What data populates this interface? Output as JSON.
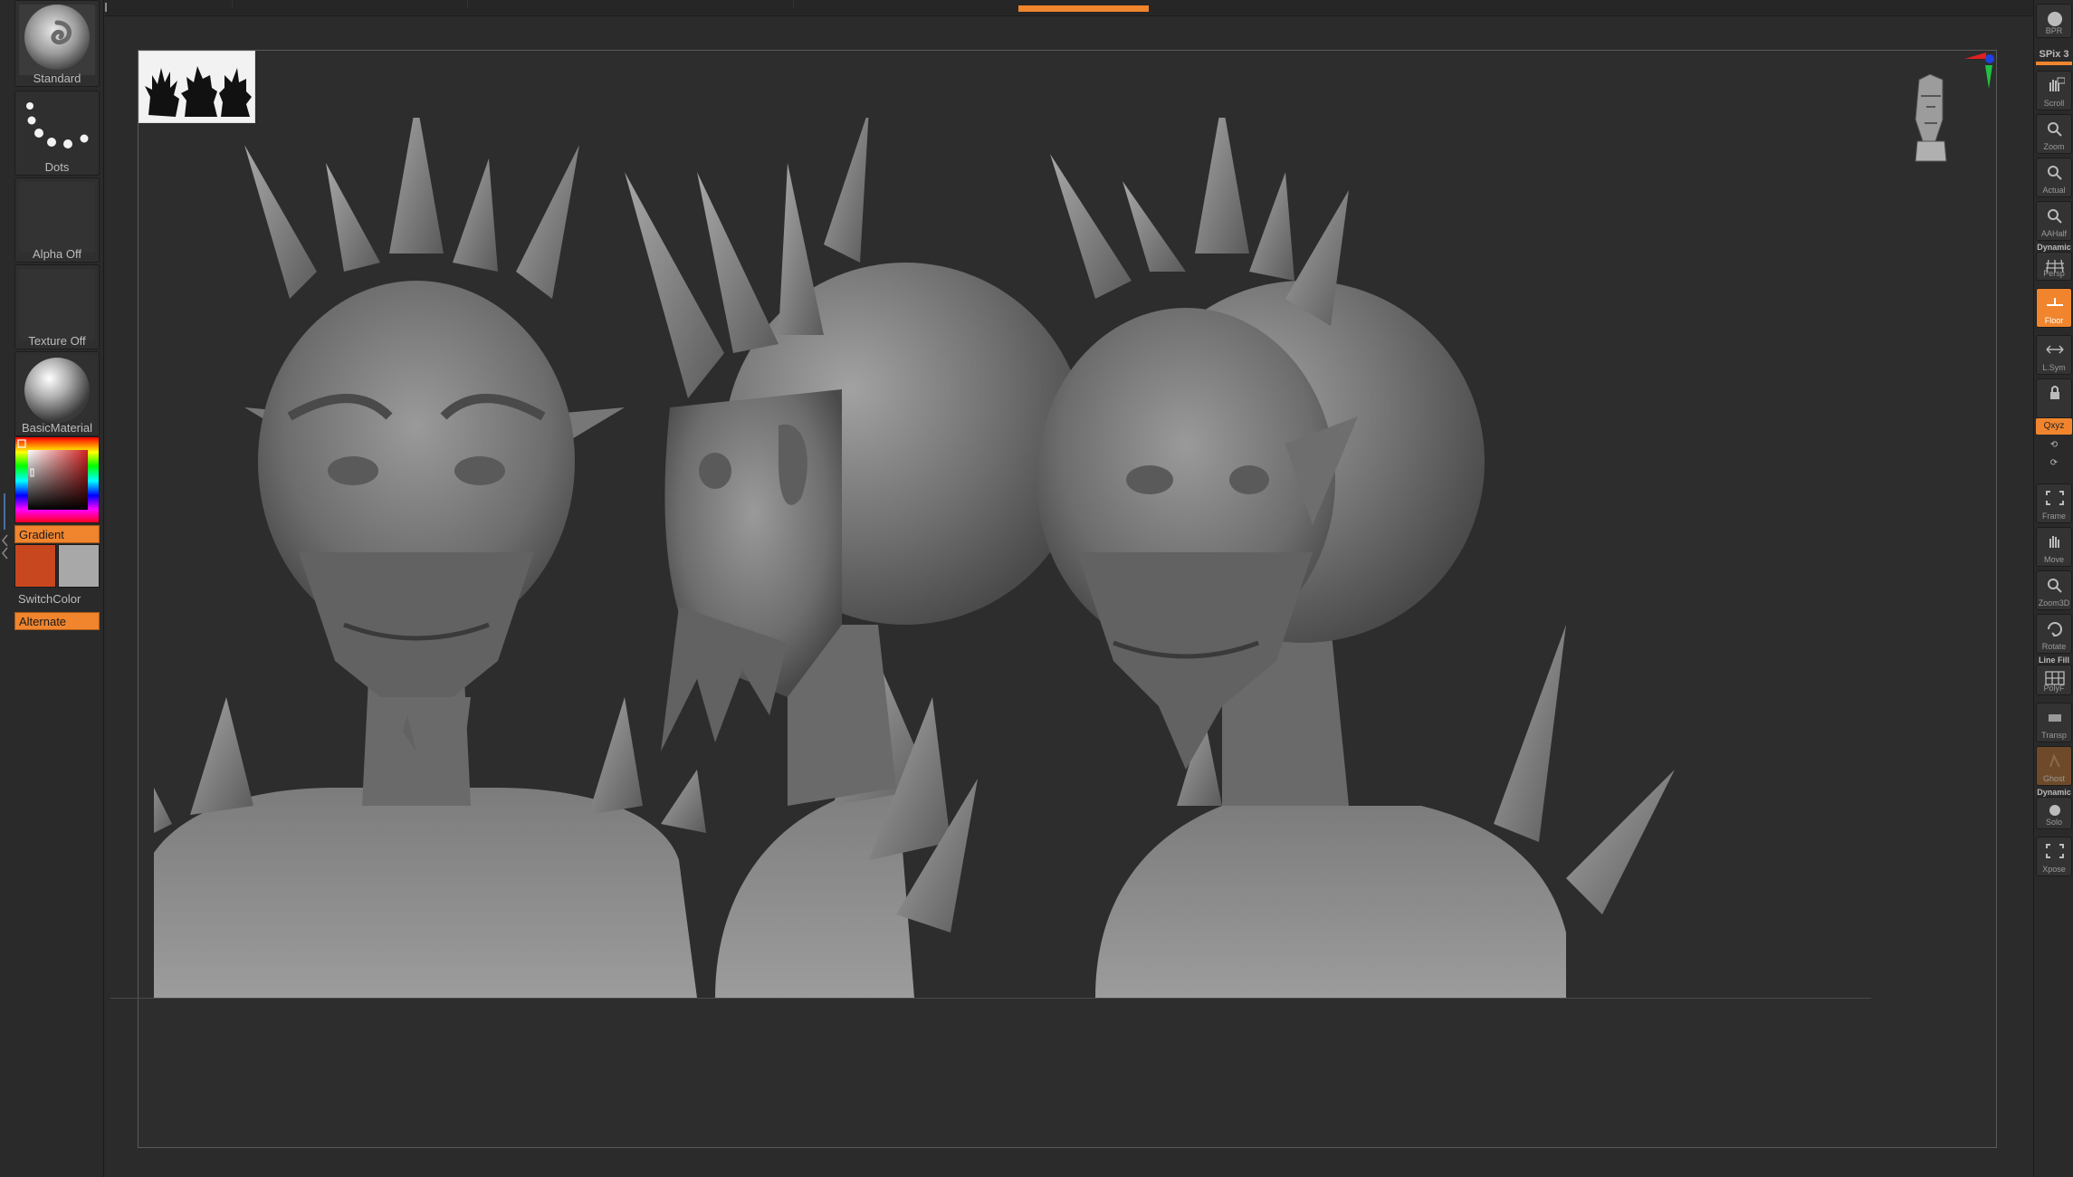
{
  "left_shelf": {
    "brush_label": "Standard",
    "stroke_label": "Dots",
    "alpha_label": "Alpha Off",
    "texture_label": "Texture Off",
    "material_label": "BasicMaterial",
    "gradient_label": "Gradient",
    "switch_color_label": "SwitchColor",
    "alternate_label": "Alternate",
    "main_color": "#c9471e",
    "secondary_color": "#a8a8a8"
  },
  "right_shelf": {
    "bpr_label": "BPR",
    "spix_label": "SPix 3",
    "dynamic_label": "Dynamic",
    "line_fill_label": "Line Fill",
    "dynamic2_label": "Dynamic",
    "xyz_label": "Qxyz",
    "buttons": {
      "scroll": "Scroll",
      "zoom": "Zoom",
      "actual": "Actual",
      "aahalf": "AAHalf",
      "persp": "Persp",
      "floor": "Floor",
      "lsym": "L.Sym",
      "frame": "Frame",
      "move": "Move",
      "zoom3d": "Zoom3D",
      "rotate": "Rotate",
      "polyf": "PolyF",
      "transp": "Transp",
      "ghost": "Ghost",
      "solo": "Solo",
      "xpose": "Xpose"
    }
  },
  "colors": {
    "accent": "#f0852e",
    "panel": "#2a2a2a",
    "canvas": "#2d2d2d",
    "clay": "#7a7a7a"
  }
}
